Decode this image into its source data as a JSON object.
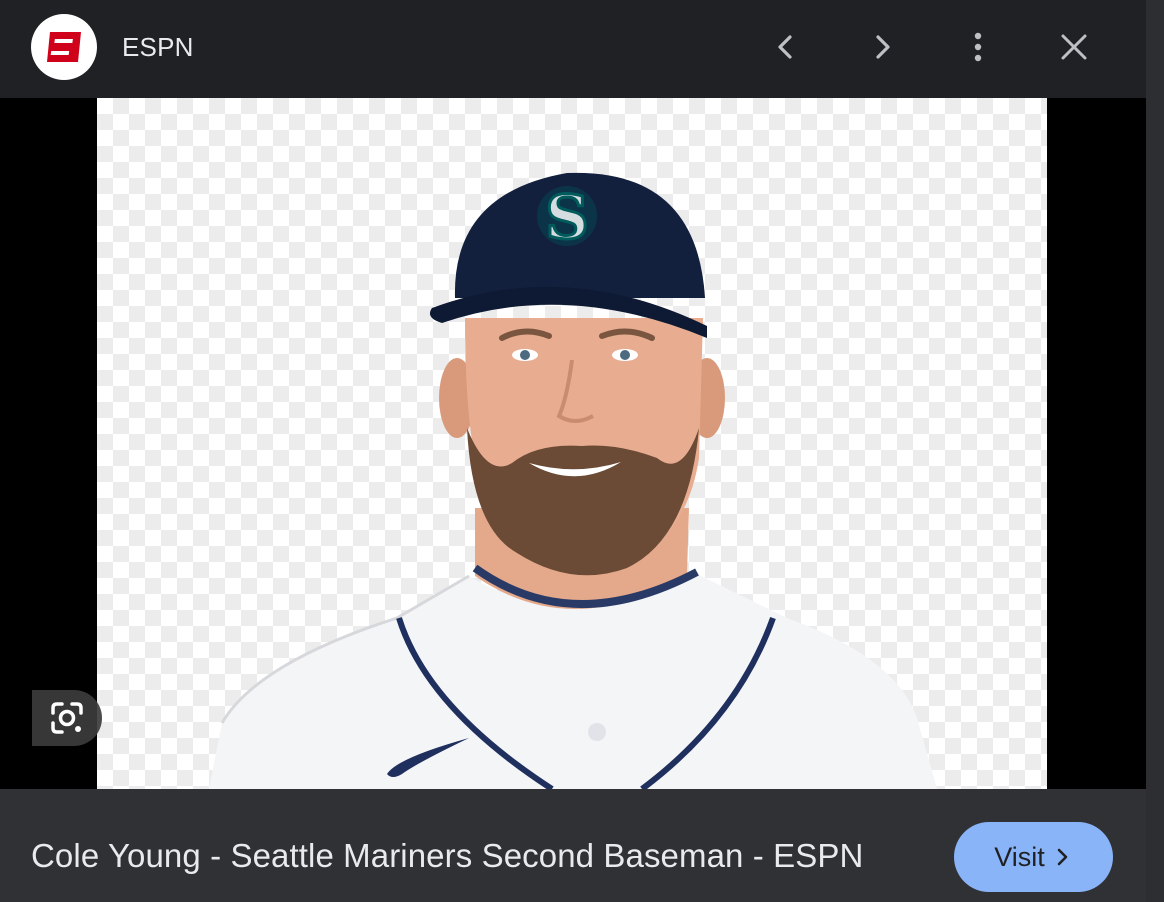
{
  "header": {
    "site_name": "ESPN",
    "logo_icon": "espn-logo",
    "actions": [
      "chevron-left-icon",
      "chevron-right-icon",
      "more-vert-icon",
      "close-icon"
    ]
  },
  "image": {
    "subject": "player-headshot",
    "cap_logo_letter": "S",
    "lens_icon": "google-lens-icon"
  },
  "footer": {
    "title": "Cole Young - Seattle Mariners Second Baseman - ESPN",
    "visit_label": "Visit"
  },
  "colors": {
    "background": "#202124",
    "footer": "#303134",
    "accent": "#8ab4f8",
    "espn_red": "#d0021b",
    "cap_navy": "#0c2c56",
    "mariners_teal": "#005c5c"
  }
}
